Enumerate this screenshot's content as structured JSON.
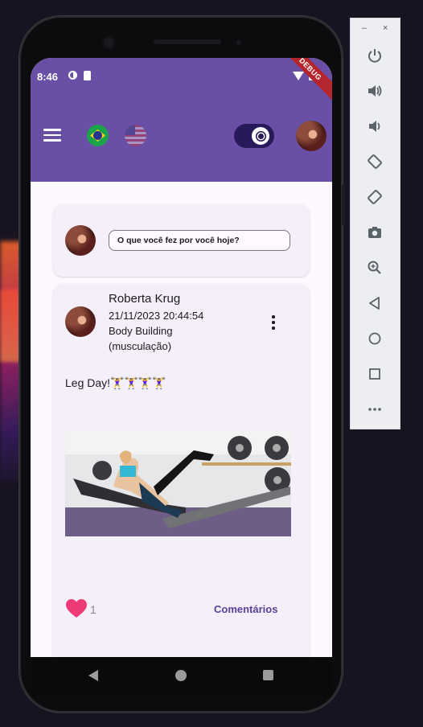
{
  "status_bar": {
    "time": "8:46",
    "debug_label": "DEBUG"
  },
  "app_bar": {
    "menu_icon": "hamburger-menu-icon",
    "language_flags": [
      "brazil-flag-icon",
      "usa-flag-icon"
    ],
    "theme_toggle_icon": "sun-icon",
    "profile_avatar": "profile-avatar"
  },
  "composer": {
    "prompt": "O que você fez por você hoje?"
  },
  "post": {
    "author": "Roberta Krug",
    "datetime": "21/11/2023 20:44:54",
    "category_line1": "Body Building",
    "category_line2": "(musculação)",
    "text": "Leg Day!🏋️‍♀️🏋️‍♀️🏋️‍♀️🏋️‍♀️",
    "likes": "1",
    "comments_label": "Comentários"
  },
  "emulator_toolbar": {
    "window_buttons": [
      "–",
      "×"
    ],
    "buttons": [
      "power-icon",
      "volume-up-icon",
      "volume-down-icon",
      "rotate-left-icon",
      "rotate-right-icon",
      "camera-icon",
      "zoom-icon",
      "back-icon",
      "home-icon",
      "overview-icon",
      "more-icon"
    ]
  },
  "colors": {
    "primary": "#6a4fa6",
    "toggle": "#27195a",
    "heart": "#ee3b77",
    "link": "#5a3f98"
  }
}
